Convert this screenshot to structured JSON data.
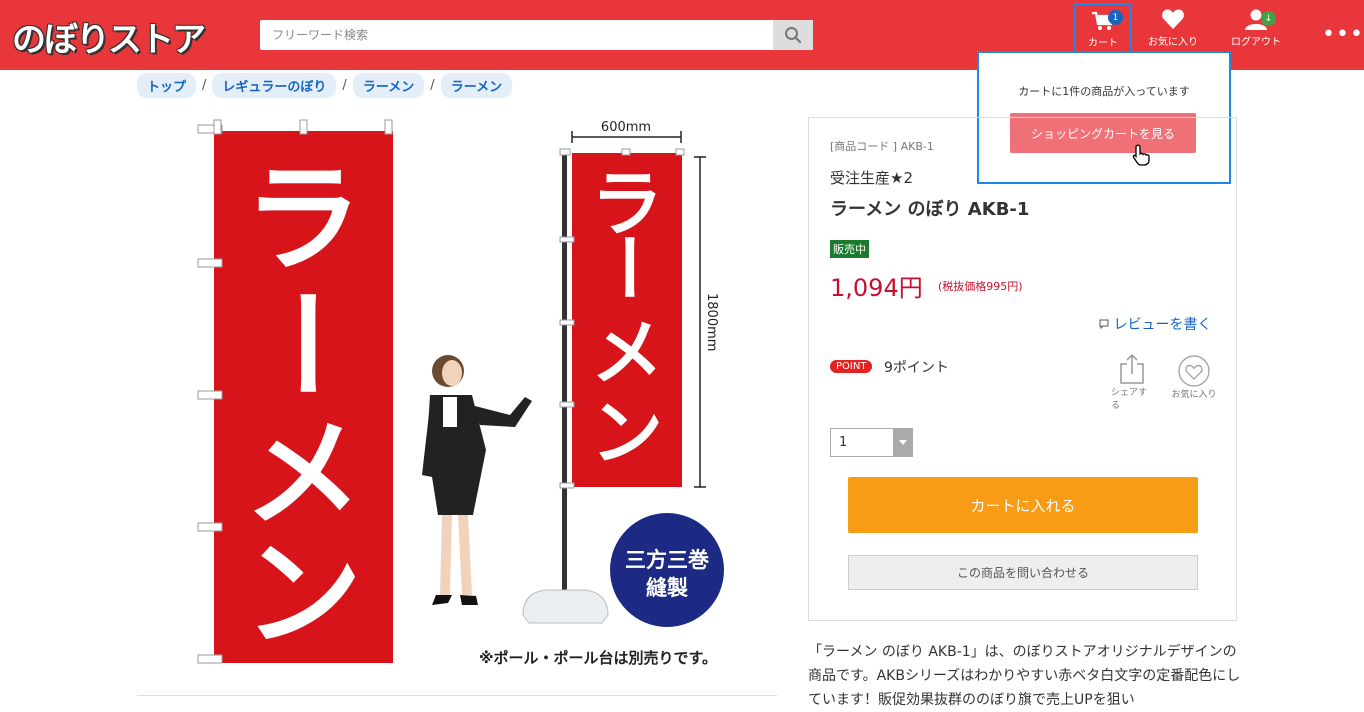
{
  "header": {
    "logo": "のぼりストア",
    "search_placeholder": "フリーワード検索",
    "nav": {
      "cart_label": "カート",
      "cart_count": "1",
      "favorite_label": "お気に入り",
      "logout_label": "ログアウト",
      "logout_badge": "↓"
    }
  },
  "cart_popup": {
    "message": "カートに1件の商品が入っています",
    "button": "ショッピングカートを見る"
  },
  "breadcrumb": [
    "トップ",
    "レギュラーのぼり",
    "ラーメン",
    "ラーメン"
  ],
  "product_image": {
    "banner_text": "ラーメン",
    "width_label": "600mm",
    "height_label": "1800mm",
    "seal_line1": "三方三巻",
    "seal_line2": "縫製",
    "note": "※ポール・ポール台は別売りです。"
  },
  "product": {
    "code": "[商品コード ] AKB-1",
    "lot": "受注生産★2",
    "name": "ラーメン のぼり AKB-1",
    "status": "販売中",
    "price": "1,094円",
    "tax_note": "(税抜価格995円)",
    "review_link": "レビューを書く",
    "point_badge": "POINT",
    "points": "9ポイント",
    "share_label": "シェアする",
    "favorite_label": "お気に入り",
    "quantity": "1",
    "add_to_cart": "カートに入れる",
    "inquire": "この商品を問い合わせる"
  },
  "description": "「ラーメン のぼり AKB-1」は、のぼりストアオリジナルデザインの商品です。AKBシリーズはわかりやすい赤ベタ白文字の定番配色にしています！販促効果抜群ののぼり旗で売上UPを狙い",
  "colors": {
    "header": "#e8363a",
    "banner_red": "#d7141a",
    "price": "#c8102e",
    "cart_button": "#f79c14",
    "popup_button": "#f07078",
    "highlight_blue": "#1e88e5"
  }
}
